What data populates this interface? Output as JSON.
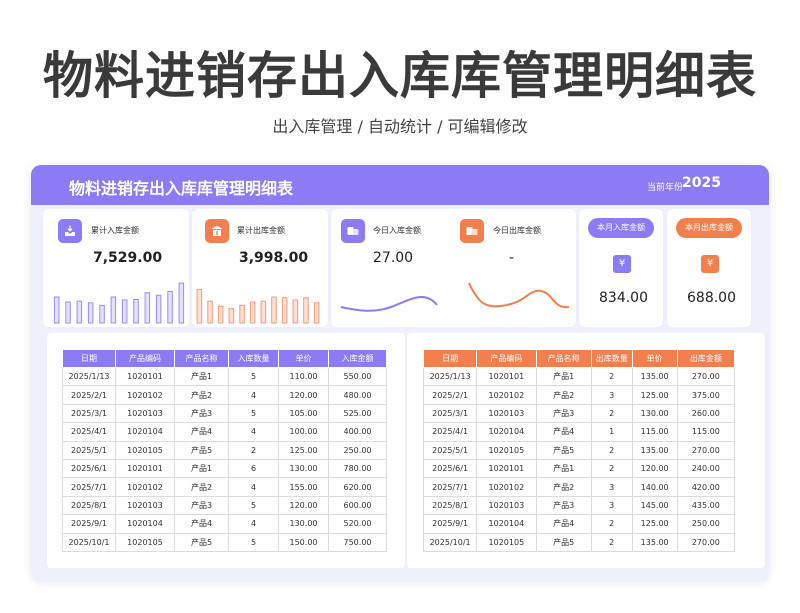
{
  "page": {
    "title": "物料进销存出入库库管理明细表",
    "subtitle": "出入库管理 /  自动统计  /  可编辑修改"
  },
  "header": {
    "title": "物料进销存出入库库管理明细表",
    "year_label": "当前年份",
    "year": "2025"
  },
  "colors": {
    "purple": "#8b7bf5",
    "orange": "#f37f4e",
    "card_bg": "#eef0fb"
  },
  "stats": {
    "cum_in": {
      "label": "累计入库金额",
      "value": "7,529.00",
      "icon": "inbox-download-icon",
      "bars": [
        0.62,
        0.5,
        0.52,
        0.48,
        0.42,
        0.62,
        0.55,
        0.56,
        0.72,
        0.66,
        0.75,
        0.95
      ]
    },
    "cum_out": {
      "label": "累计出库金额",
      "value": "3,998.00",
      "icon": "outbox-upload-icon",
      "bars": [
        0.8,
        0.52,
        0.4,
        0.34,
        0.42,
        0.5,
        0.52,
        0.62,
        0.6,
        0.55,
        0.6,
        0.48
      ]
    },
    "today_in": {
      "label": "今日入库金额",
      "value": "27.00",
      "icon": "boxes-icon"
    },
    "today_out": {
      "label": "今日出库金额",
      "value": "-",
      "icon": "boxes-icon"
    },
    "month_in": {
      "label": "本月入库金额",
      "value": "834.00",
      "icon": "yen-icon",
      "icon_glyph": "¥"
    },
    "month_out": {
      "label": "本月出库金额",
      "value": "688.00",
      "icon": "yen-icon",
      "icon_glyph": "¥"
    }
  },
  "inbound": {
    "headers": [
      "日期",
      "产品编码",
      "产品名称",
      "入库数量",
      "单价",
      "入库金额"
    ],
    "rows": [
      [
        "2025/1/13",
        "1020101",
        "产品1",
        "5",
        "110.00",
        "550.00"
      ],
      [
        "2025/2/1",
        "1020102",
        "产品2",
        "4",
        "120.00",
        "480.00"
      ],
      [
        "2025/3/1",
        "1020103",
        "产品3",
        "5",
        "105.00",
        "525.00"
      ],
      [
        "2025/4/1",
        "1020104",
        "产品4",
        "4",
        "100.00",
        "400.00"
      ],
      [
        "2025/5/1",
        "1020105",
        "产品5",
        "2",
        "125.00",
        "250.00"
      ],
      [
        "2025/6/1",
        "1020101",
        "产品1",
        "6",
        "130.00",
        "780.00"
      ],
      [
        "2025/7/1",
        "1020102",
        "产品2",
        "4",
        "155.00",
        "620.00"
      ],
      [
        "2025/8/1",
        "1020103",
        "产品3",
        "5",
        "120.00",
        "600.00"
      ],
      [
        "2025/9/1",
        "1020104",
        "产品4",
        "4",
        "130.00",
        "520.00"
      ],
      [
        "2025/10/1",
        "1020105",
        "产品5",
        "5",
        "150.00",
        "750.00"
      ]
    ]
  },
  "outbound": {
    "headers": [
      "日期",
      "产品编码",
      "产品名称",
      "出库数量",
      "单价",
      "出库金额"
    ],
    "rows": [
      [
        "2025/1/13",
        "1020101",
        "产品1",
        "2",
        "135.00",
        "270.00"
      ],
      [
        "2025/2/1",
        "1020102",
        "产品2",
        "3",
        "125.00",
        "375.00"
      ],
      [
        "2025/3/1",
        "1020103",
        "产品3",
        "2",
        "130.00",
        "260.00"
      ],
      [
        "2025/4/1",
        "1020104",
        "产品4",
        "1",
        "115.00",
        "115.00"
      ],
      [
        "2025/5/1",
        "1020105",
        "产品5",
        "2",
        "135.00",
        "270.00"
      ],
      [
        "2025/6/1",
        "1020101",
        "产品1",
        "2",
        "120.00",
        "240.00"
      ],
      [
        "2025/7/1",
        "1020102",
        "产品2",
        "3",
        "140.00",
        "420.00"
      ],
      [
        "2025/8/1",
        "1020103",
        "产品3",
        "3",
        "145.00",
        "435.00"
      ],
      [
        "2025/9/1",
        "1020104",
        "产品4",
        "2",
        "125.00",
        "250.00"
      ],
      [
        "2025/10/1",
        "1020105",
        "产品5",
        "2",
        "135.00",
        "270.00"
      ]
    ]
  }
}
